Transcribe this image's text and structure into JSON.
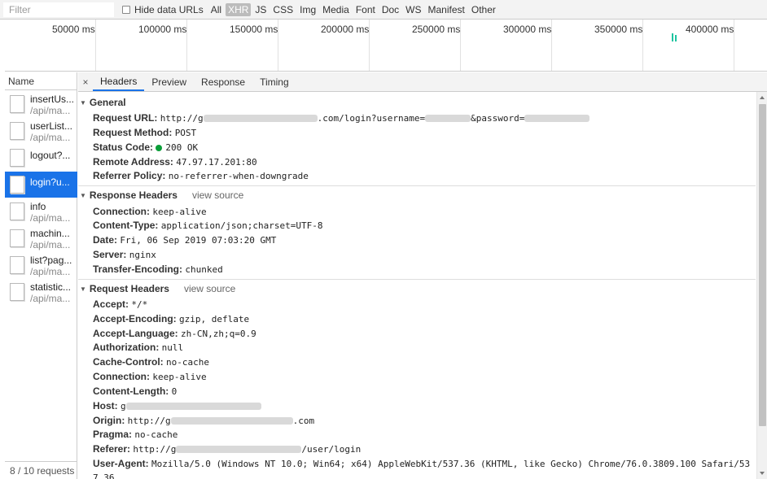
{
  "filter": {
    "placeholder": "Filter",
    "hide_data_urls_label": "Hide data URLs"
  },
  "type_filters": [
    "All",
    "XHR",
    "JS",
    "CSS",
    "Img",
    "Media",
    "Font",
    "Doc",
    "WS",
    "Manifest",
    "Other"
  ],
  "active_type": "XHR",
  "timeline_ticks": [
    "50000 ms",
    "100000 ms",
    "150000 ms",
    "200000 ms",
    "250000 ms",
    "300000 ms",
    "350000 ms",
    "400000 ms"
  ],
  "request_list": {
    "header": "Name",
    "items": [
      {
        "name": "insertUs...",
        "path": "/api/ma..."
      },
      {
        "name": "userList...",
        "path": "/api/ma..."
      },
      {
        "name": "logout?...",
        "path": ""
      },
      {
        "name": "login?u...",
        "path": "",
        "selected": true
      },
      {
        "name": "info",
        "path": "/api/ma..."
      },
      {
        "name": "machin...",
        "path": "/api/ma..."
      },
      {
        "name": "list?pag...",
        "path": "/api/ma..."
      },
      {
        "name": "statistic...",
        "path": "/api/ma..."
      }
    ],
    "status": "8 / 10 requests"
  },
  "detail_tabs": {
    "close": "×",
    "items": [
      "Headers",
      "Preview",
      "Response",
      "Timing"
    ],
    "active": "Headers"
  },
  "general": {
    "title": "General",
    "request_url_label": "Request URL:",
    "request_url_part1": "http://g",
    "request_url_part2": ".com/login?username=",
    "request_url_part3": "&password=",
    "request_method_label": "Request Method:",
    "request_method": "POST",
    "status_code_label": "Status Code:",
    "status_code": "200 OK",
    "status_color": "#0a9d38",
    "remote_address_label": "Remote Address:",
    "remote_address": "47.97.17.201:80",
    "referrer_policy_label": "Referrer Policy:",
    "referrer_policy": "no-referrer-when-downgrade"
  },
  "response_headers": {
    "title": "Response Headers",
    "view_source": "view source",
    "rows": [
      {
        "k": "Connection:",
        "v": "keep-alive"
      },
      {
        "k": "Content-Type:",
        "v": "application/json;charset=UTF-8"
      },
      {
        "k": "Date:",
        "v": "Fri, 06 Sep 2019 07:03:20 GMT"
      },
      {
        "k": "Server:",
        "v": "nginx"
      },
      {
        "k": "Transfer-Encoding:",
        "v": "chunked"
      }
    ]
  },
  "request_headers": {
    "title": "Request Headers",
    "view_source": "view source",
    "accept": {
      "k": "Accept:",
      "v": "*/*"
    },
    "accept_encoding": {
      "k": "Accept-Encoding:",
      "v": "gzip, deflate"
    },
    "accept_language": {
      "k": "Accept-Language:",
      "v": "zh-CN,zh;q=0.9"
    },
    "authorization": {
      "k": "Authorization:",
      "v": "null"
    },
    "cache_control": {
      "k": "Cache-Control:",
      "v": "no-cache"
    },
    "connection": {
      "k": "Connection:",
      "v": "keep-alive"
    },
    "content_length": {
      "k": "Content-Length:",
      "v": "0"
    },
    "host": {
      "k": "Host:",
      "v": "g"
    },
    "origin": {
      "k": "Origin:",
      "v": "http://g",
      "v_suffix": ".com"
    },
    "pragma": {
      "k": "Pragma:",
      "v": "no-cache"
    },
    "referer": {
      "k": "Referer:",
      "v": "http://g",
      "v_suffix": "/user/login"
    },
    "user_agent": {
      "k": "User-Agent:",
      "v": "Mozilla/5.0 (Windows NT 10.0; Win64; x64) AppleWebKit/537.36 (KHTML, like Gecko) Chrome/76.0.3809.100 Safari/53",
      "v_wrap": "7.36"
    }
  }
}
